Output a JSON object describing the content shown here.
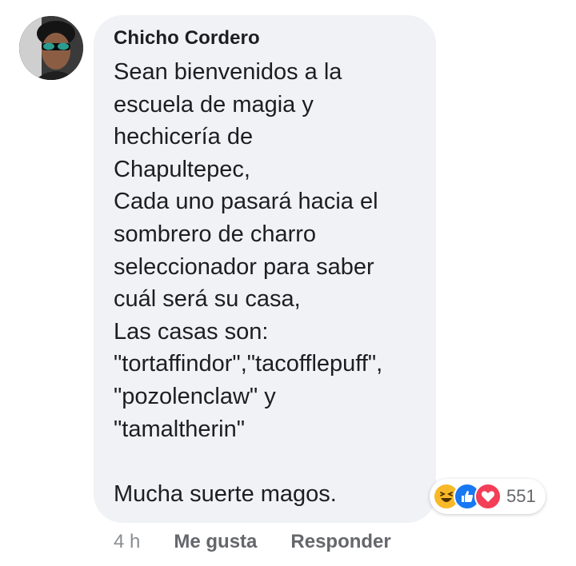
{
  "comment": {
    "author": "Chicho Cordero",
    "lines": [
      "Sean bienvenidos a la",
      "escuela de magia y",
      "hechicería de",
      "Chapultepec,",
      "Cada uno pasará hacia el",
      "sombrero de charro",
      "seleccionador para saber",
      "cuál será su casa,",
      "Las casas son:",
      "\"tortaffindor\",\"tacofflepuff\",",
      "\"pozolenclaw\" y",
      "\"tamaltherin\"",
      "",
      "Mucha suerte magos."
    ]
  },
  "reactions": {
    "icons": [
      "haha-icon",
      "like-icon",
      "love-icon"
    ],
    "count": "551",
    "colors": {
      "haha": "#f7b928",
      "like": "#1877f2",
      "love": "#f33e58"
    }
  },
  "actions": {
    "time": "4 h",
    "like_label": "Me gusta",
    "reply_label": "Responder"
  }
}
